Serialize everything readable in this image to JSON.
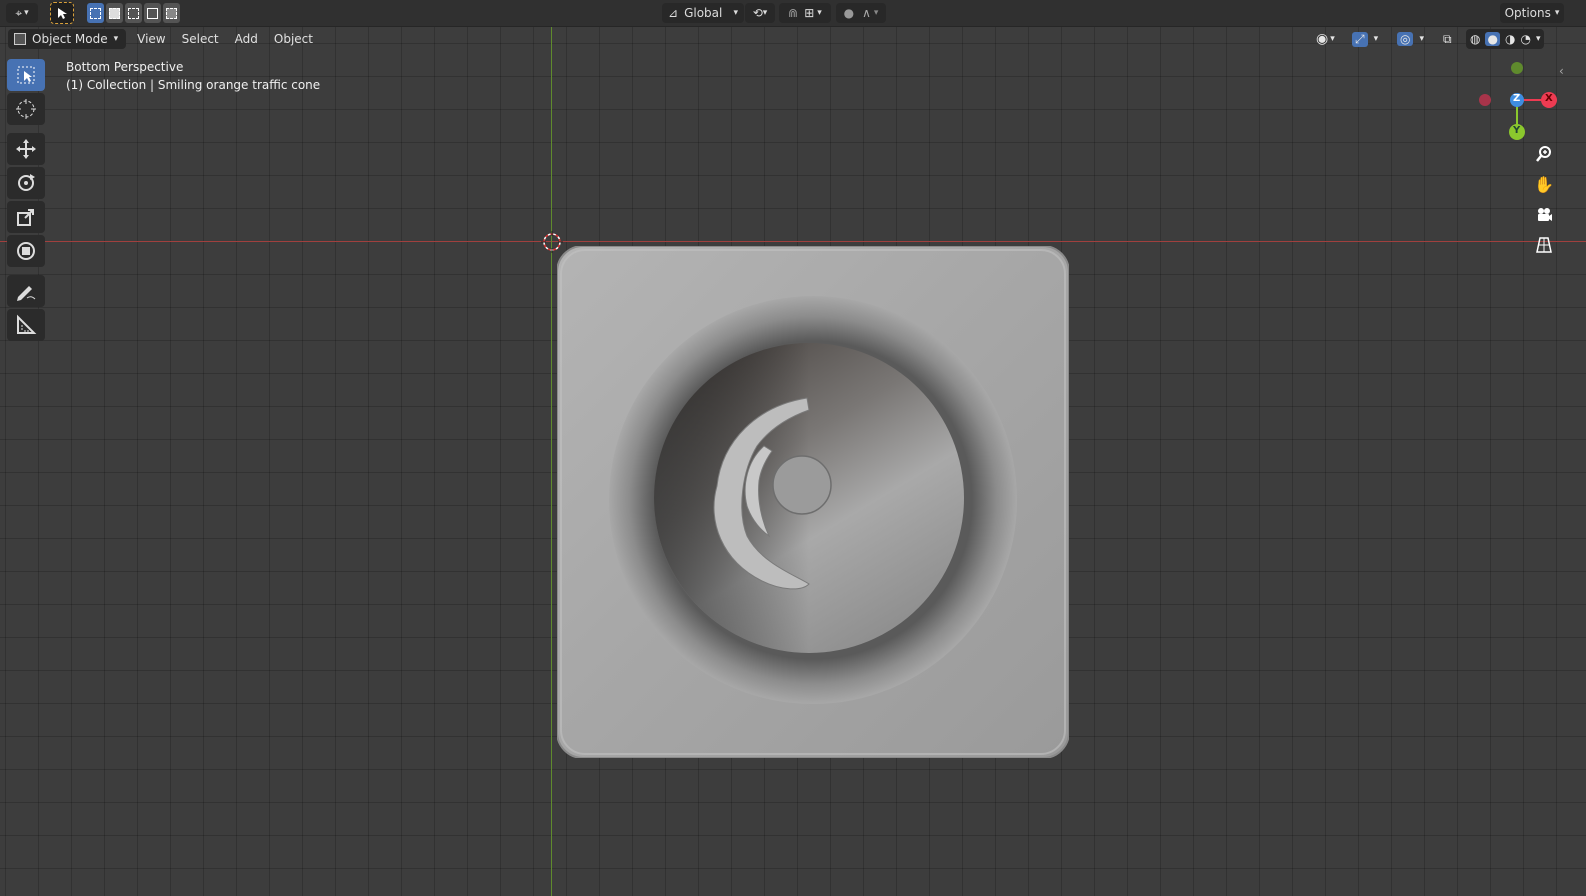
{
  "header": {
    "transform_orientation": "Global",
    "options_label": "Options"
  },
  "menu": {
    "mode": "Object Mode",
    "items": [
      "View",
      "Select",
      "Add",
      "Object"
    ]
  },
  "viewport": {
    "view_name": "Bottom Perspective",
    "collection_info": "(1) Collection | Smiling orange traffic cone"
  },
  "gizmo": {
    "x_label": "X",
    "y_label": "Y",
    "z_label": "Z",
    "colors": {
      "x": "#ee3b52",
      "y": "#8bc82d",
      "z": "#3f8de0"
    }
  },
  "toolbar": {
    "tools": [
      "select-box",
      "cursor",
      "move",
      "rotate",
      "scale",
      "transform",
      "annotate",
      "measure"
    ],
    "active": "select-box"
  }
}
